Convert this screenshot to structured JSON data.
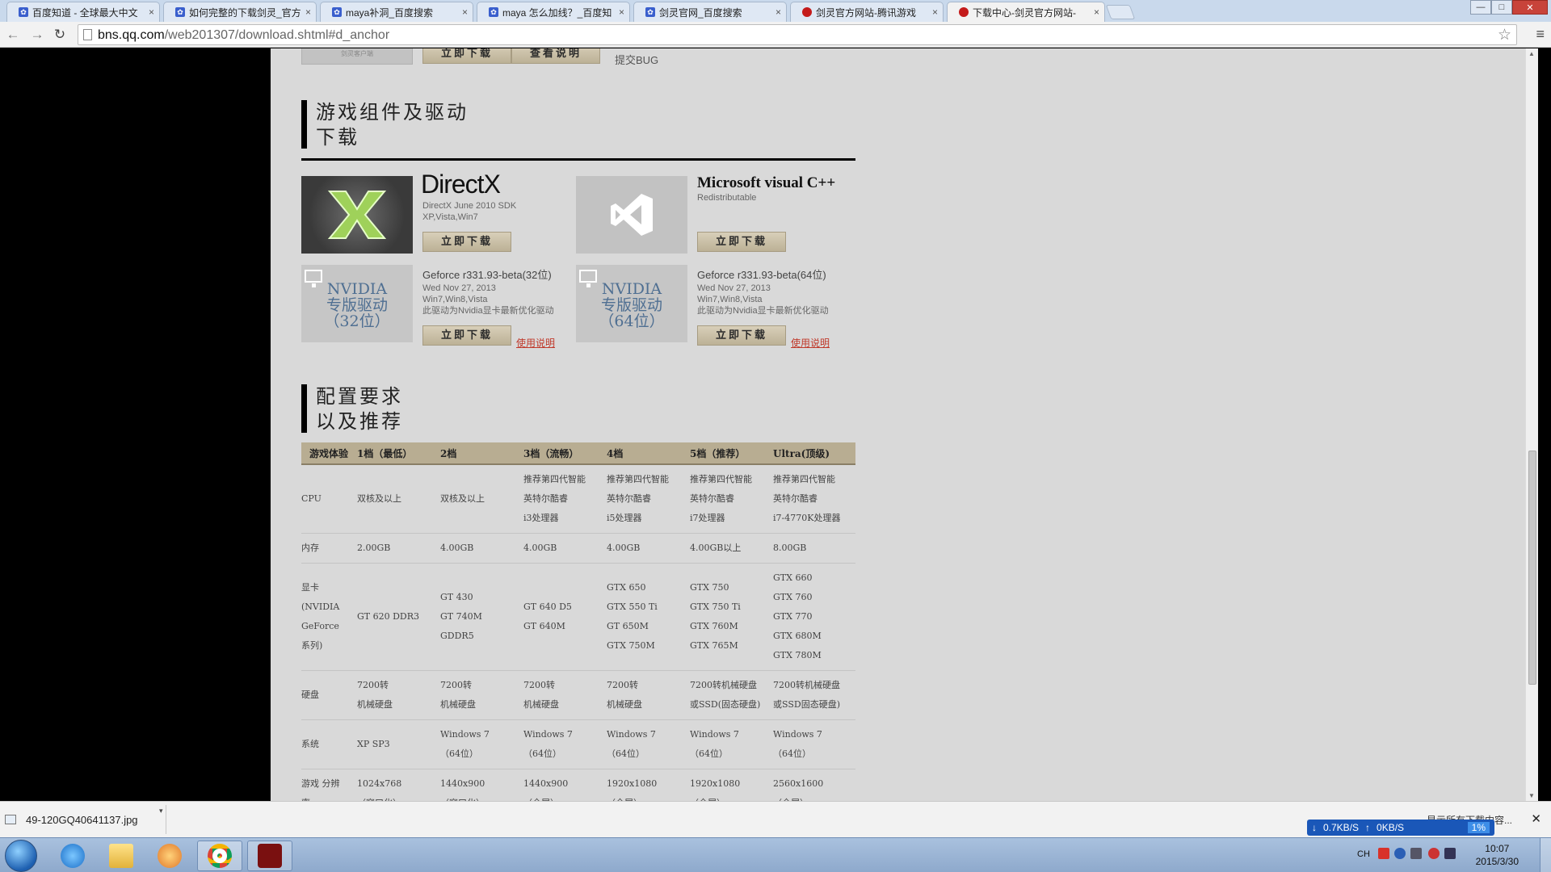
{
  "browser": {
    "tabs": [
      {
        "label": "百度知道 - 全球最大中文",
        "favicon": "paw-icon",
        "active": false
      },
      {
        "label": "如何完整的下载剑灵_官方",
        "favicon": "paw-icon",
        "active": false
      },
      {
        "label": "maya补洞_百度搜索",
        "favicon": "paw-icon",
        "active": false
      },
      {
        "label": "maya 怎么加线？_百度知",
        "favicon": "paw-icon",
        "active": false
      },
      {
        "label": "剑灵官网_百度搜索",
        "favicon": "paw-icon",
        "active": false
      },
      {
        "label": "剑灵官方网站-腾讯游戏",
        "favicon": "bns-icon",
        "active": false
      },
      {
        "label": "下载中心-剑灵官方网站-",
        "favicon": "bns-icon",
        "active": true
      }
    ],
    "tab_close": "×",
    "win_minimize": "—",
    "win_maximize": "□",
    "win_close": "✕",
    "back": "←",
    "forward": "→",
    "reload": "↻",
    "url_host": "bns.qq.com",
    "url_path": "/web201307/download.shtml#d_anchor",
    "star": "☆",
    "menu": "≡"
  },
  "page": {
    "top": {
      "thumb_text": "剑灵客户端",
      "download_label": "立即下载",
      "readme_label": "查看说明",
      "bug_text": "提交BUG"
    },
    "components": {
      "title_line1": "游戏组件及驱动",
      "title_line2": "下载",
      "directx": {
        "logo_text": "DirectX",
        "sub1": "DirectX June 2010 SDK",
        "sub2": "XP,Vista,Win7",
        "button": "立即下载"
      },
      "vcpp": {
        "title": "Microsoft visual C++",
        "sub1": "Redistributable",
        "button": "立即下载"
      },
      "nvidia32": {
        "img_line1": "NVIDIA",
        "img_line2": "专版驱动",
        "img_line3": "（32位）",
        "title": "Geforce r331.93-beta(32位)",
        "sub1": "Wed Nov 27, 2013",
        "sub2": "Win7,Win8,Vista",
        "sub3": "此驱动为Nvidia显卡最新优化驱动",
        "button": "立即下载",
        "help": "使用说明"
      },
      "nvidia64": {
        "img_line1": "NVIDIA",
        "img_line2": "专版驱动",
        "img_line3": "（64位）",
        "title": "Geforce r331.93-beta(64位)",
        "sub1": "Wed Nov 27, 2013",
        "sub2": "Win7,Win8,Vista",
        "sub3": "此驱动为Nvidia显卡最新优化驱动",
        "button": "立即下载",
        "help": "使用说明"
      }
    },
    "requirements": {
      "title_line1": "配置要求",
      "title_line2": "以及推荐",
      "headers": [
        "游戏体验",
        "1档（最低）",
        "2档",
        "3档（流畅）",
        "4档",
        "5档（推荐）",
        "Ultra(顶级)"
      ],
      "rows": [
        {
          "name": "CPU",
          "cells": [
            [
              "双核及以上"
            ],
            [
              "双核及以上"
            ],
            [
              "推荐第四代智能",
              "英特尔酷睿",
              "i3处理器"
            ],
            [
              "推荐第四代智能",
              "英特尔酷睿",
              "i5处理器"
            ],
            [
              "推荐第四代智能",
              "英特尔酷睿",
              "i7处理器"
            ],
            [
              "推荐第四代智能",
              "英特尔酷睿",
              "i7-4770K处理器"
            ]
          ]
        },
        {
          "name": "内存",
          "cells": [
            [
              "2.00GB"
            ],
            [
              "4.00GB"
            ],
            [
              "4.00GB"
            ],
            [
              "4.00GB"
            ],
            [
              "4.00GB以上"
            ],
            [
              "8.00GB"
            ]
          ]
        },
        {
          "name": "显卡 (NVIDIA GeForce系列)",
          "cells": [
            [
              "GT 620 DDR3"
            ],
            [
              "GT 430",
              "GT 740M GDDR5"
            ],
            [
              "GT 640 D5",
              "GT 640M"
            ],
            [
              "GTX 650",
              "GTX 550 Ti",
              "GT 650M",
              "GTX 750M"
            ],
            [
              "GTX 750",
              "GTX 750 Ti",
              "GTX 760M",
              "GTX 765M"
            ],
            [
              "GTX 660",
              "GTX 760",
              "GTX 770",
              "GTX 680M",
              "GTX 780M"
            ]
          ]
        },
        {
          "name": "硬盘",
          "cells": [
            [
              "7200转",
              "机械硬盘"
            ],
            [
              "7200转",
              "机械硬盘"
            ],
            [
              "7200转",
              "机械硬盘"
            ],
            [
              "7200转",
              "机械硬盘"
            ],
            [
              "7200转机械硬盘",
              "或SSD(固态硬盘)"
            ],
            [
              "7200转机械硬盘",
              "或SSD固态硬盘)"
            ]
          ]
        },
        {
          "name": "系统",
          "cells": [
            [
              "XP SP3"
            ],
            [
              "Windows 7",
              "（64位）"
            ],
            [
              "Windows 7",
              "（64位）"
            ],
            [
              "Windows 7",
              "（64位）"
            ],
            [
              "Windows 7",
              "（64位）"
            ],
            [
              "Windows 7",
              "（64位）"
            ]
          ]
        },
        {
          "name": "游戏 分辨率",
          "cells": [
            [
              "1024x768",
              "（窗口化）"
            ],
            [
              "1440x900",
              "（窗口化）"
            ],
            [
              "1440x900",
              "（全屏）"
            ],
            [
              "1920x1080",
              "（全屏）"
            ],
            [
              "1920x1080",
              "（全屏）"
            ],
            [
              "2560x1600",
              "（全屏）"
            ]
          ]
        }
      ]
    }
  },
  "downloads": {
    "file": "49-120GQ40641137.jpg",
    "arrow": "▾",
    "show_all": "显示所有下载内容...",
    "close": "✕",
    "net_down": "0.7KB/S",
    "net_up": "0KB/S",
    "net_pct": "1%"
  },
  "taskbar": {
    "lang": "CH",
    "time": "10:07",
    "date": "2015/3/30"
  }
}
